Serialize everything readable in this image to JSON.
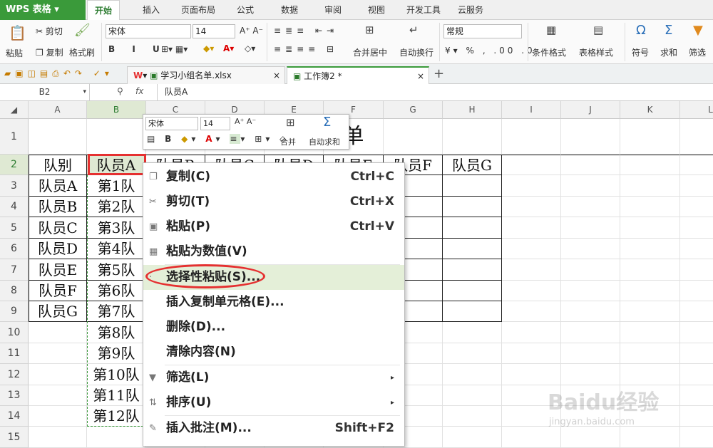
{
  "app": {
    "title": "WPS 表格",
    "tabs": [
      "开始",
      "插入",
      "页面布局",
      "公式",
      "数据",
      "审阅",
      "视图",
      "开发工具",
      "云服务"
    ]
  },
  "ribbon": {
    "paste": "粘贴",
    "cut": "剪切",
    "copy": "复制",
    "format_painter": "格式刷",
    "font": "宋体",
    "size": "14",
    "merge_center": "合并居中",
    "wrap": "自动换行",
    "number_format": "常规",
    "conditional": "条件格式",
    "table_style": "表格样式",
    "symbol": "符号",
    "sum": "求和",
    "filter": "筛选"
  },
  "docs": [
    {
      "name": "学习小组名单.xlsx"
    },
    {
      "name": "工作簿2 *"
    }
  ],
  "formula": {
    "cell": "B2",
    "fx": "fx",
    "value": "队员A"
  },
  "columns": [
    "A",
    "B",
    "C",
    "D",
    "E",
    "F",
    "G",
    "H",
    "I",
    "J",
    "K",
    "L"
  ],
  "rows": [
    "1",
    "2",
    "3",
    "4",
    "5",
    "6",
    "7",
    "8",
    "9",
    "10",
    "11",
    "12",
    "13",
    "14",
    "15"
  ],
  "sheet": {
    "title_visible": "单",
    "header": [
      "队别",
      "队员A",
      "队员B",
      "队员C",
      "队员D",
      "队员E",
      "队员F",
      "队员G"
    ],
    "colA": [
      "队员A",
      "队员B",
      "队员C",
      "队员D",
      "队员E",
      "队员F",
      "队员G"
    ],
    "colB": [
      "第1队",
      "第2队",
      "第3队",
      "第4队",
      "第5队",
      "第6队",
      "第7队",
      "第8队",
      "第9队",
      "第10队",
      "第11队",
      "第12队"
    ]
  },
  "mini_toolbar": {
    "font": "宋体",
    "size": "14",
    "merge": "合并",
    "autosum": "自动求和"
  },
  "context_menu": [
    {
      "label": "复制(C)",
      "shortcut": "Ctrl+C",
      "icon": "copy-icon"
    },
    {
      "label": "剪切(T)",
      "shortcut": "Ctrl+X",
      "icon": "scissors-icon"
    },
    {
      "label": "粘贴(P)",
      "shortcut": "Ctrl+V",
      "icon": "paste-icon"
    },
    {
      "label": "粘贴为数值(V)",
      "shortcut": "",
      "icon": "paste-values-icon"
    },
    {
      "label": "选择性粘贴(S)...",
      "shortcut": "",
      "icon": "paste-special-icon"
    },
    {
      "label": "插入复制单元格(E)...",
      "shortcut": "",
      "icon": ""
    },
    {
      "label": "删除(D)...",
      "shortcut": "",
      "icon": ""
    },
    {
      "label": "清除内容(N)",
      "shortcut": "",
      "icon": ""
    },
    {
      "label": "筛选(L)",
      "shortcut": "",
      "icon": "filter-icon"
    },
    {
      "label": "排序(U)",
      "shortcut": "",
      "icon": "sort-icon"
    },
    {
      "label": "插入批注(M)...",
      "shortcut": "Shift+F2",
      "icon": "comment-icon"
    }
  ],
  "watermark": {
    "brand": "Baidu经验",
    "url": "jingyan.baidu.com"
  },
  "colors": {
    "green": "#3a9a3a",
    "highlight": "#e4efd8",
    "red_mark": "#e53030"
  }
}
